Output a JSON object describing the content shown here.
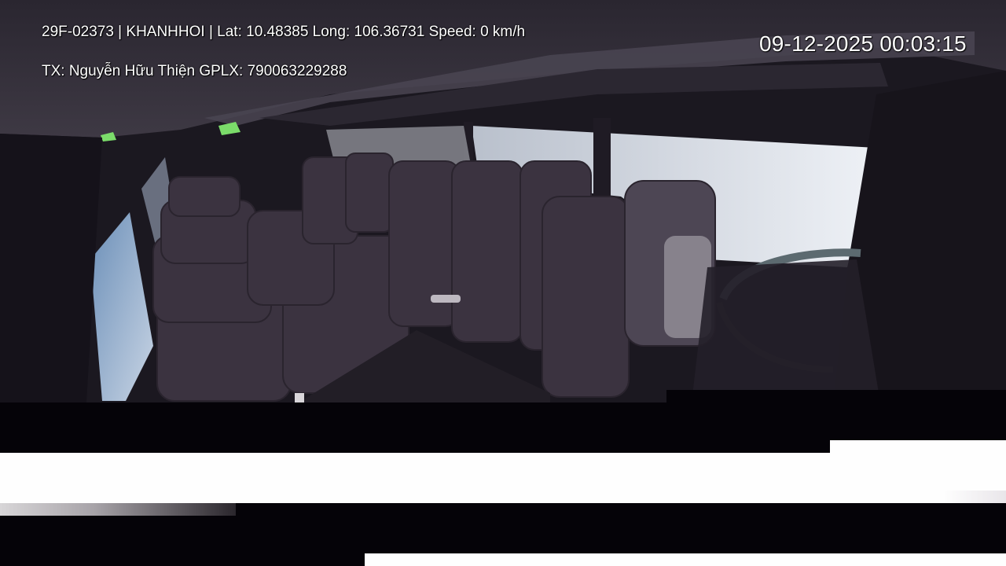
{
  "overlay": {
    "vehicle_line": "29F-02373 | KHANHHOI | Lat: 10.48385 Long: 106.36731 Speed: 0 km/h",
    "driver_line": "TX: Nguyễn Hữu Thiện GPLX: 790063229288",
    "timestamp": "09-12-2025 00:03:15"
  },
  "colors": {
    "osd_text": "#ffffff",
    "cabin_dark": "#1b1820",
    "window_light": "#dfe4ec",
    "seat": "#3b3340",
    "sign_green": "#7bdc6a",
    "band_black": "#050308",
    "band_white": "#fefefe"
  }
}
